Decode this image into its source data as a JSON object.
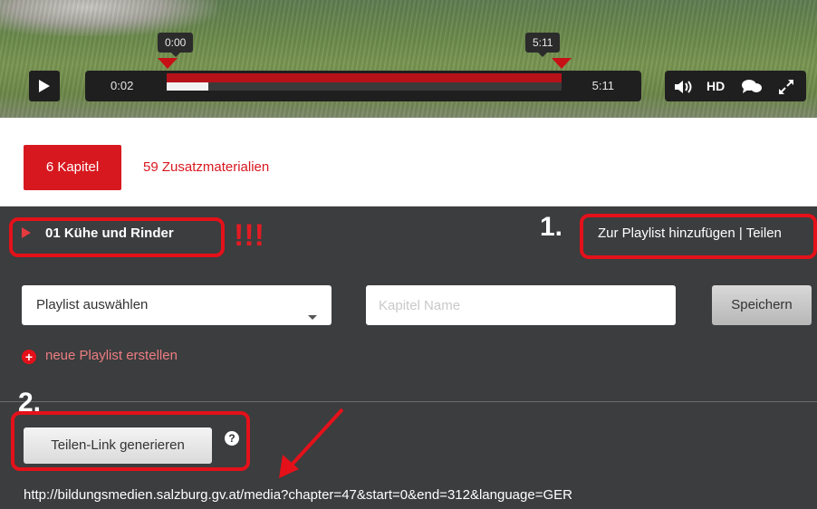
{
  "video": {
    "range_start_label": "0:00",
    "range_end_label": "5:11",
    "current_time": "0:02",
    "duration": "5:11",
    "progress": 0.0064,
    "buffered": 0.1,
    "play_icon": "play-icon",
    "volume_icon": "volume-icon",
    "hd_label": "HD",
    "comments_icon": "comments-icon",
    "fullscreen_icon": "fullscreen-icon",
    "accent_color": "#b5121a"
  },
  "tabs": {
    "chapters": "6 Kapitel",
    "materials": "59 Zusatzmaterialien"
  },
  "panel": {
    "chapter_title": "01 Kühe und Rinder",
    "annotation_marks": "!!!",
    "step1": "1.",
    "playlist_actions": "Zur Playlist hinzufügen | Teilen",
    "playlist_select": "Playlist auswählen",
    "chapter_name_placeholder": "Kapitel Name",
    "save_label": "Speichern",
    "new_playlist": "neue Playlist erstellen",
    "step2": "2.",
    "share_button": "Teilen-Link generieren",
    "help": "?",
    "share_url": "http://bildungsmedien.salzburg.gv.at/media?chapter=47&start=0&end=312&language=GER"
  },
  "colors": {
    "brand_red": "#d8181f",
    "annotation_red": "#e4111a",
    "panel_bg": "#3b3d3e"
  }
}
